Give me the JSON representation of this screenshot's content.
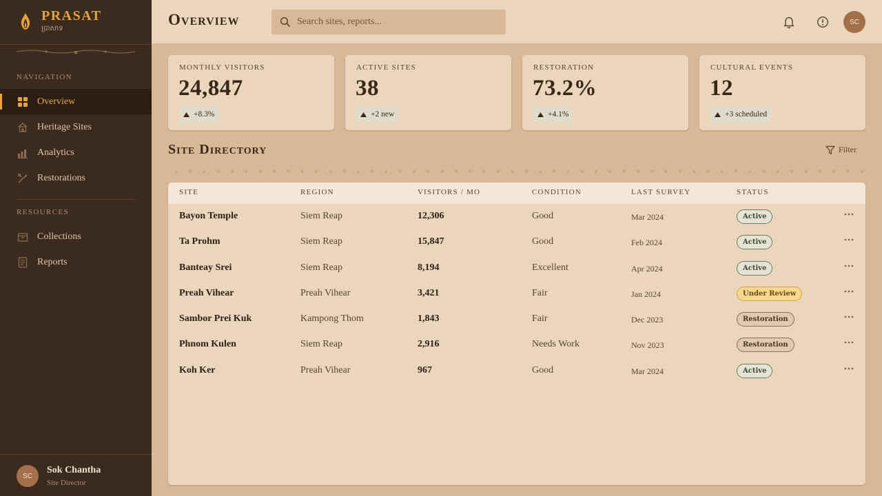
{
  "brand": {
    "name": "PRASAT",
    "subtitle": "ប្រាសាទ"
  },
  "sidebar": {
    "nav_label": "NAVIGATION",
    "nav_items": [
      {
        "label": "Overview",
        "icon": "grid-icon",
        "active": true
      },
      {
        "label": "Heritage Sites",
        "icon": "temple-icon",
        "active": false
      },
      {
        "label": "Analytics",
        "icon": "bar-chart-icon",
        "active": false
      },
      {
        "label": "Restorations",
        "icon": "tools-icon",
        "active": false
      }
    ],
    "resources_label": "RESOURCES",
    "resource_items": [
      {
        "label": "Collections",
        "icon": "archive-icon"
      },
      {
        "label": "Reports",
        "icon": "document-icon"
      }
    ],
    "user": {
      "initials": "SC",
      "name": "Sok Chantha",
      "role": "Site Director"
    }
  },
  "header": {
    "title": "Overview",
    "search_placeholder": "Search sites, reports...",
    "avatar_initials": "SC"
  },
  "stats": [
    {
      "label": "MONTHLY VISITORS",
      "value": "24,847",
      "change": "+8.3%"
    },
    {
      "label": "ACTIVE SITES",
      "value": "38",
      "change": "+2 new"
    },
    {
      "label": "RESTORATION",
      "value": "73.2%",
      "change": "+4.1%"
    },
    {
      "label": "CULTURAL EVENTS",
      "value": "12",
      "change": "+3 scheduled"
    }
  ],
  "directory": {
    "title": "Site Directory",
    "filter_label": "Filter",
    "columns": [
      "SITE",
      "REGION",
      "VISITORS / MO",
      "CONDITION",
      "LAST SURVEY",
      "STATUS"
    ],
    "rows": [
      {
        "site": "Bayon Temple",
        "region": "Siem Reap",
        "visitors": "12,306",
        "condition": "Good",
        "survey": "Mar 2024",
        "status": "Active"
      },
      {
        "site": "Ta Prohm",
        "region": "Siem Reap",
        "visitors": "15,847",
        "condition": "Good",
        "survey": "Feb 2024",
        "status": "Active"
      },
      {
        "site": "Banteay Srei",
        "region": "Siem Reap",
        "visitors": "8,194",
        "condition": "Excellent",
        "survey": "Apr 2024",
        "status": "Active"
      },
      {
        "site": "Preah Vihear",
        "region": "Preah Vihear",
        "visitors": "3,421",
        "condition": "Fair",
        "survey": "Jan 2024",
        "status": "Under Review"
      },
      {
        "site": "Sambor Prei Kuk",
        "region": "Kampong Thom",
        "visitors": "1,843",
        "condition": "Fair",
        "survey": "Dec 2023",
        "status": "Restoration"
      },
      {
        "site": "Phnom Kulen",
        "region": "Siem Reap",
        "visitors": "2,916",
        "condition": "Needs Work",
        "survey": "Nov 2023",
        "status": "Restoration"
      },
      {
        "site": "Koh Ker",
        "region": "Preah Vihear",
        "visitors": "967",
        "condition": "Good",
        "survey": "Mar 2024",
        "status": "Active"
      }
    ]
  },
  "colors": {
    "accent": "#e6a33d",
    "sidebar_bg": "#3b2a1e",
    "page_bg": "#d9b898",
    "card_bg": "#ead6bd"
  }
}
